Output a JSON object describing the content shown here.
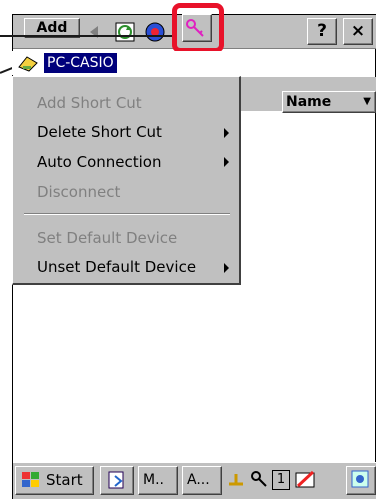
{
  "toolbar": {
    "add_label": "Add",
    "help_label": "?",
    "close_label": "×"
  },
  "device": {
    "label": "PC-CASIO"
  },
  "list": {
    "column_header": "Name"
  },
  "menu": {
    "items": [
      {
        "label": "Add Short Cut",
        "enabled": false,
        "submenu": false
      },
      {
        "label": "Delete Short Cut",
        "enabled": true,
        "submenu": true
      },
      {
        "label": "Auto Connection",
        "enabled": true,
        "submenu": true
      },
      {
        "label": "Disconnect",
        "enabled": false,
        "submenu": false
      },
      {
        "label": "Set Default Device",
        "enabled": false,
        "submenu": false
      },
      {
        "label": "Unset Default Device",
        "enabled": true,
        "submenu": true
      }
    ]
  },
  "taskbar": {
    "start_label": "Start",
    "task1_label": "M..",
    "task2_label": "A...",
    "tray_number": "1"
  },
  "colors": {
    "highlight": "#e8122a",
    "selection": "#00007b",
    "chrome": "#c0c0c0"
  }
}
